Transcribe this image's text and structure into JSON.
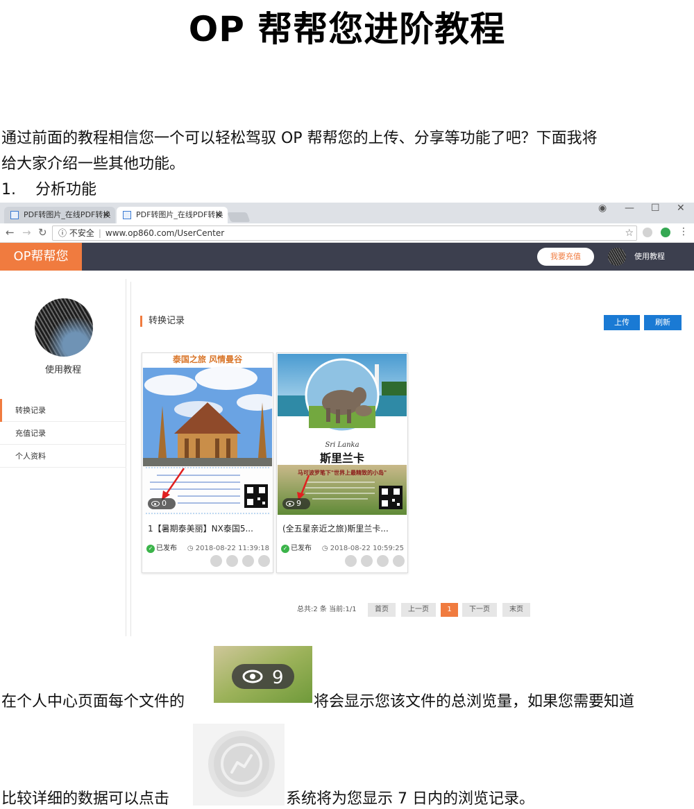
{
  "document": {
    "title": "OP 帮帮您进阶教程",
    "intro_line1": "通过前面的教程相信您一个可以轻松驾驭 OP 帮帮您的上传、分享等功能了吧？下面我将",
    "intro_line2": "给大家介绍一些其他功能。",
    "section_number": "1.",
    "section_title": "分析功能",
    "para2_before": "在个人中心页面每个文件的",
    "para2_after": "将会显示您该文件的总浏览量，如果您需要知道",
    "para3_before": "比较详细的数据可以点击",
    "para3_after": "系统将为您显示 7 日内的浏览记录。",
    "inline_views_count": "9"
  },
  "browser": {
    "tabs": [
      {
        "label": "PDF转图片_在线PDF转换",
        "close": "✕"
      },
      {
        "label": "PDF转图片_在线PDF转换",
        "close": "✕"
      }
    ],
    "security_label": "不安全",
    "url": "www.op860.com/UserCenter"
  },
  "app": {
    "logo": "OP帮帮您",
    "recharge_button": "我要充值",
    "header_user": "使用教程",
    "sidebar": {
      "username": "使用教程",
      "menu": [
        "转换记录",
        "充值记录",
        "个人资料"
      ]
    },
    "section_title": "转换记录",
    "upload_button": "上传",
    "refresh_button": "刷新",
    "cards": [
      {
        "title": "1【暑期泰美丽】NX泰国5...",
        "views": "0",
        "status": "已发布",
        "date": "2018-08-22 11:39:18",
        "banner_text": "泰国之旅 风情曼谷"
      },
      {
        "title": "(全五星亲近之旅)斯里兰卡...",
        "views": "9",
        "status": "已发布",
        "date": "2018-08-22 10:59:25",
        "script_text": "Sri Lanka",
        "headline": "斯里兰卡",
        "slogan": "马可波罗笔下\"世界上最精致的小岛\""
      }
    ],
    "pagination": {
      "summary": "总共:2 条 当前:1/1",
      "first": "首页",
      "prev": "上一页",
      "current": "1",
      "next": "下一页",
      "last": "末页"
    }
  },
  "colors": {
    "accent_orange": "#f07b3f",
    "header_dark": "#3c3f4e",
    "button_blue": "#1a7ad4",
    "status_green": "#3bb44a"
  },
  "icons": [
    "eye-icon",
    "analytics-icon",
    "check-icon",
    "reload-icon",
    "star-icon"
  ]
}
